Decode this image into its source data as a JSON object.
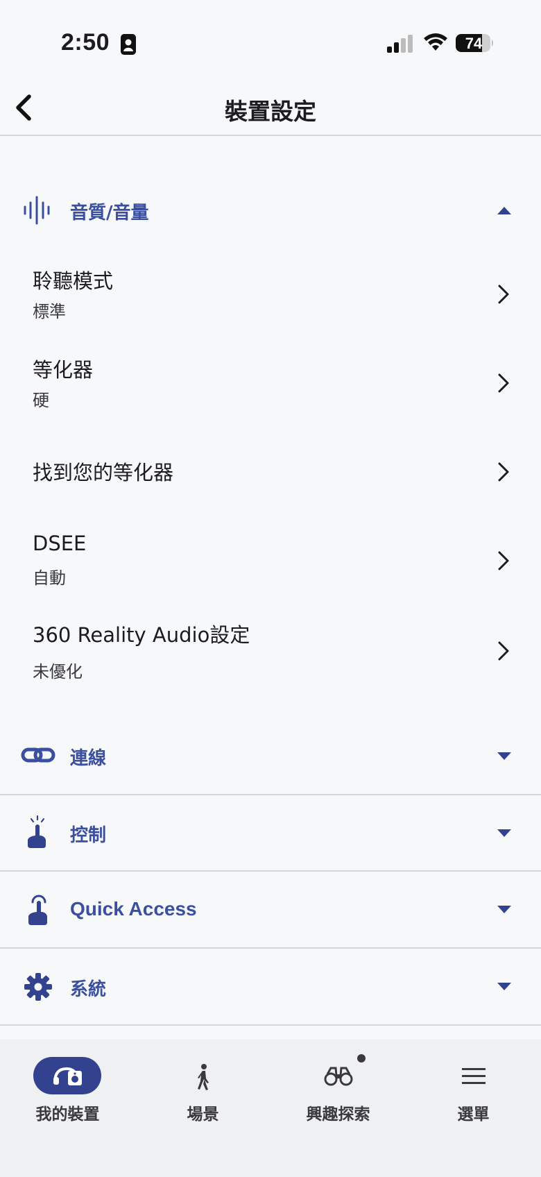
{
  "status_bar": {
    "time": "2:50",
    "battery": "74"
  },
  "header": {
    "title": "裝置設定",
    "back_icon": "chevron-left-icon"
  },
  "colors": {
    "accent": "#3b4fa0",
    "tab_active": "#33428f"
  },
  "sections": {
    "sound": {
      "label": "音質/音量",
      "icon": "waveform-icon",
      "expanded": true,
      "items": [
        {
          "title": "聆聽模式",
          "value": "標準"
        },
        {
          "title": "等化器",
          "value": "硬"
        },
        {
          "title": "找到您的等化器",
          "value": ""
        },
        {
          "title": "DSEE",
          "value": "自動"
        },
        {
          "title": "360 Reality Audio設定",
          "value": "未優化"
        }
      ]
    },
    "connection": {
      "label": "連線",
      "icon": "link-icon",
      "expanded": false
    },
    "control": {
      "label": "控制",
      "icon": "tap-gesture-icon",
      "expanded": false
    },
    "quick_access": {
      "label": "Quick Access",
      "icon": "hand-press-icon",
      "expanded": false
    },
    "system": {
      "label": "系統",
      "icon": "gear-icon",
      "expanded": false
    }
  },
  "tabbar": {
    "tabs": [
      {
        "label": "我的裝置",
        "icon": "headphones-speaker-icon",
        "active": true
      },
      {
        "label": "場景",
        "icon": "walking-person-icon",
        "active": false
      },
      {
        "label": "興趣探索",
        "icon": "binoculars-icon",
        "active": false,
        "badge": true
      },
      {
        "label": "選單",
        "icon": "menu-icon",
        "active": false
      }
    ]
  }
}
